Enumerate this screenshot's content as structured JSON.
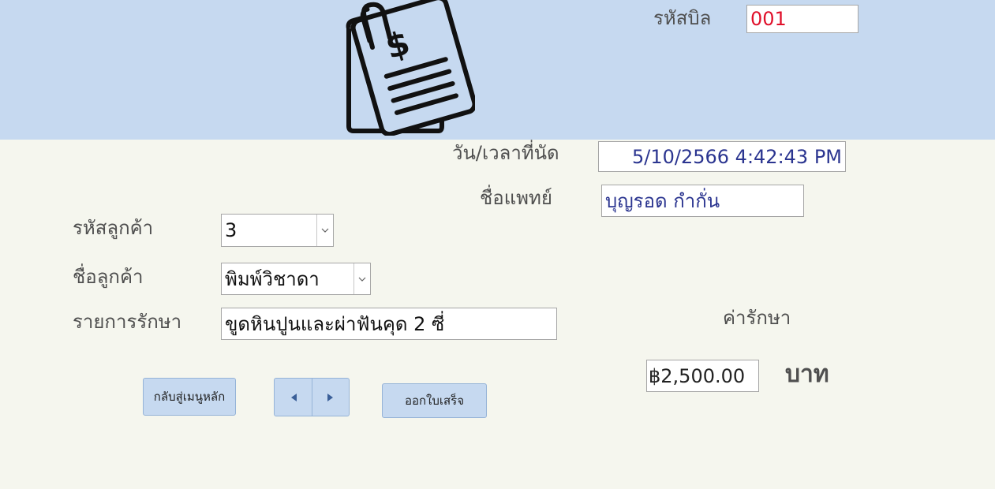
{
  "header": {
    "bill_id_label": "รหัสบิล",
    "bill_id_value": "001"
  },
  "appointment": {
    "datetime_label": "วัน/เวลาที่นัด",
    "datetime_value": "5/10/2566 4:42:43 PM",
    "doctor_label": "ชื่อแพทย์",
    "doctor_value": "บุญรอด กำกั่น"
  },
  "customer": {
    "id_label": "รหัสลูกค้า",
    "id_value": "3",
    "name_label": "ชื่อลูกค้า",
    "name_value": "พิมพ์วิชาดา"
  },
  "treatment": {
    "label": "รายการรักษา",
    "value": "ขูดหินปูนและผ่าฟันคุด 2 ซี่"
  },
  "fee": {
    "label": "ค่ารักษา",
    "value": "฿2,500.00",
    "unit": "บาท"
  },
  "buttons": {
    "back_to_menu": "กลับสู่เมนูหลัก",
    "issue_receipt": "ออกใบเสร็จ"
  },
  "icons": {
    "logo": "invoice-document-icon",
    "prev": "triangle-left-icon",
    "next": "triangle-right-icon",
    "dropdown": "chevron-down-icon"
  },
  "colors": {
    "header_bg": "#c6d9f0",
    "body_bg": "#f5f6ee",
    "bill_id_text": "#e0102a",
    "field_text": "#2b3590",
    "label_text": "#4f4f4f"
  }
}
